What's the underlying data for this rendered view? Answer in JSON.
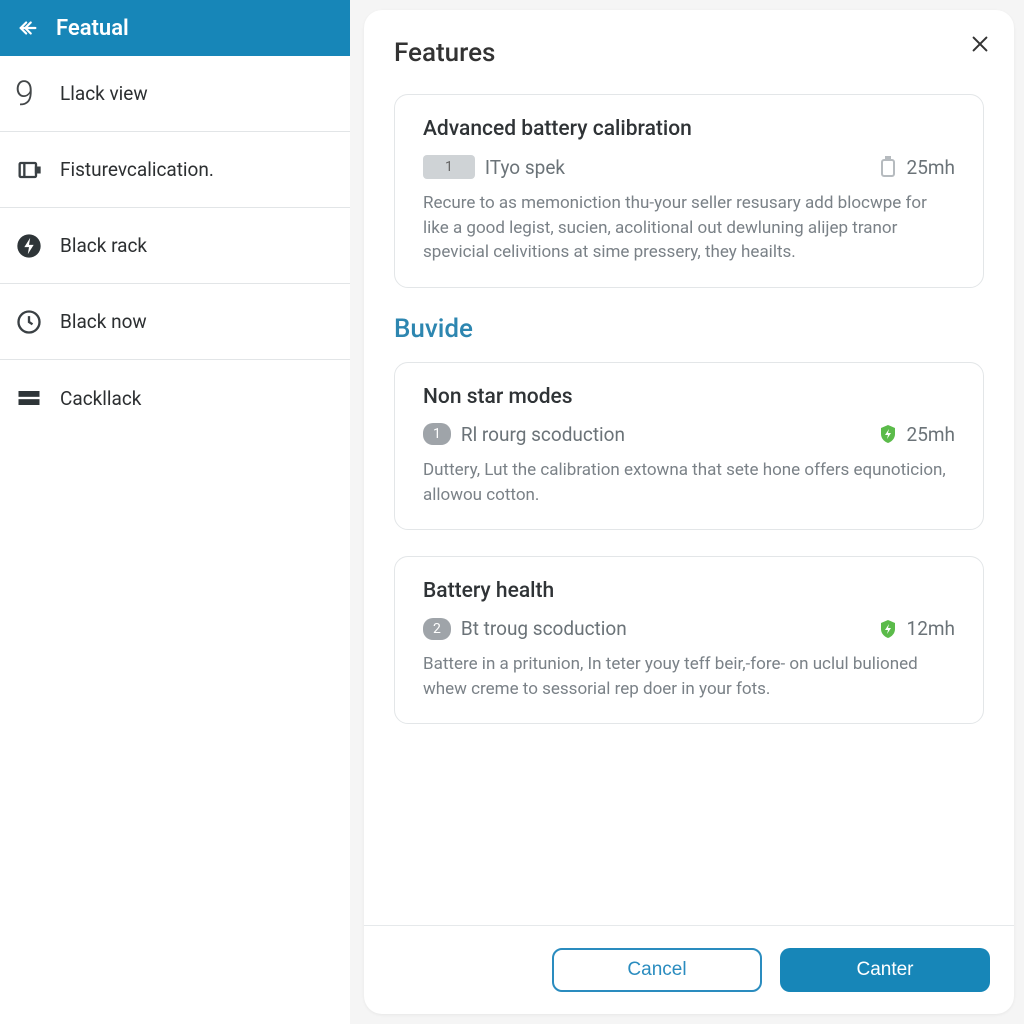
{
  "sidebar": {
    "title": "Featual",
    "items": [
      {
        "label": "Llack view"
      },
      {
        "label": "Fisturevcalication."
      },
      {
        "label": "Black rack"
      },
      {
        "label": "Black now"
      },
      {
        "label": "Cackllack"
      }
    ]
  },
  "panel": {
    "title": "Features",
    "section_title": "Buvide",
    "cards": [
      {
        "title": "Advanced battery calibration",
        "badge": "1",
        "sub": "ITyo spek",
        "meta": "25mh",
        "desc": "Recure to as memoniction thu-your seller resusary add blocwpe for like a good legist, sucien, acolitional out dewluning alijep tranor spevicial celivitions at sime pressery, they heailts."
      },
      {
        "title": "Non star modes",
        "badge": "1",
        "sub": "Rl rourg scoduction",
        "meta": "25mh",
        "desc": "Duttery, Lut the calibration extowna that sete hone offers equnoticion, allowou cotton."
      },
      {
        "title": "Battery health",
        "badge": "2",
        "sub": "Bt troug scoduction",
        "meta": "12mh",
        "desc": "Battere in a pritunion, In teter youy teff beir,-fore- on uclul bulioned whew creme to sessorial rep doer in your fots."
      }
    ],
    "footer": {
      "cancel": "Cancel",
      "confirm": "Canter"
    }
  }
}
